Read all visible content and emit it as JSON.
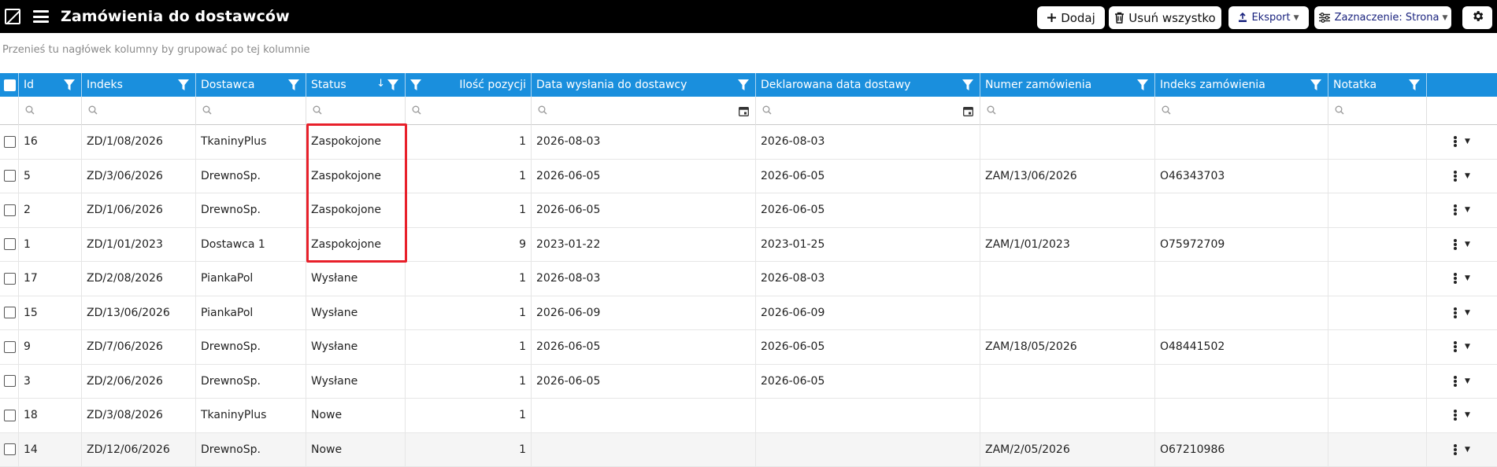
{
  "header": {
    "title": "Zamówienia do dostawców",
    "add_label": "Dodaj",
    "delete_all_label": "Usuń wszystko",
    "export_label": "Eksport",
    "selection_label": "Zaznaczenie: Strona"
  },
  "group_panel": {
    "hint": "Przenieś tu nagłówek kolumny by grupować po tej kolumnie"
  },
  "grid": {
    "columns": {
      "id": "Id",
      "index": "Indeks",
      "supplier": "Dostawca",
      "status": "Status",
      "item_count": "Ilość pozycji",
      "sent_date": "Data wysłania do dostawcy",
      "declared_date": "Deklarowana data dostawy",
      "order_number": "Numer zamówienia",
      "order_index": "Indeks zamówienia",
      "note": "Notatka"
    },
    "sort": {
      "column": "status",
      "direction": "descending"
    },
    "rows": [
      {
        "id": "16",
        "index": "ZD/1/08/2026",
        "supplier": "TkaninyPlus",
        "status": "Zaspokojone",
        "items": "1",
        "sent": "2026-08-03",
        "declared": "2026-08-03",
        "order_no": "",
        "order_index": "",
        "note": ""
      },
      {
        "id": "5",
        "index": "ZD/3/06/2026",
        "supplier": "DrewnoSp.",
        "status": "Zaspokojone",
        "items": "1",
        "sent": "2026-06-05",
        "declared": "2026-06-05",
        "order_no": "ZAM/13/06/2026",
        "order_index": "O46343703",
        "note": ""
      },
      {
        "id": "2",
        "index": "ZD/1/06/2026",
        "supplier": "DrewnoSp.",
        "status": "Zaspokojone",
        "items": "1",
        "sent": "2026-06-05",
        "declared": "2026-06-05",
        "order_no": "",
        "order_index": "",
        "note": ""
      },
      {
        "id": "1",
        "index": "ZD/1/01/2023",
        "supplier": "Dostawca 1",
        "status": "Zaspokojone",
        "items": "9",
        "sent": "2023-01-22",
        "declared": "2023-01-25",
        "order_no": "ZAM/1/01/2023",
        "order_index": "O75972709",
        "note": ""
      },
      {
        "id": "17",
        "index": "ZD/2/08/2026",
        "supplier": "PiankaPol",
        "status": "Wysłane",
        "items": "1",
        "sent": "2026-08-03",
        "declared": "2026-08-03",
        "order_no": "",
        "order_index": "",
        "note": ""
      },
      {
        "id": "15",
        "index": "ZD/13/06/2026",
        "supplier": "PiankaPol",
        "status": "Wysłane",
        "items": "1",
        "sent": "2026-06-09",
        "declared": "2026-06-09",
        "order_no": "",
        "order_index": "",
        "note": ""
      },
      {
        "id": "9",
        "index": "ZD/7/06/2026",
        "supplier": "DrewnoSp.",
        "status": "Wysłane",
        "items": "1",
        "sent": "2026-06-05",
        "declared": "2026-06-05",
        "order_no": "ZAM/18/05/2026",
        "order_index": "O48441502",
        "note": ""
      },
      {
        "id": "3",
        "index": "ZD/2/06/2026",
        "supplier": "DrewnoSp.",
        "status": "Wysłane",
        "items": "1",
        "sent": "2026-06-05",
        "declared": "2026-06-05",
        "order_no": "",
        "order_index": "",
        "note": ""
      },
      {
        "id": "18",
        "index": "ZD/3/08/2026",
        "supplier": "TkaninyPlus",
        "status": "Nowe",
        "items": "1",
        "sent": "",
        "declared": "",
        "order_no": "",
        "order_index": "",
        "note": ""
      },
      {
        "id": "14",
        "index": "ZD/12/06/2026",
        "supplier": "DrewnoSp.",
        "status": "Nowe",
        "items": "1",
        "sent": "",
        "declared": "",
        "order_no": "ZAM/2/05/2026",
        "order_index": "O67210986",
        "note": ""
      }
    ]
  },
  "icons": {
    "logo": "app-logo-icon",
    "menu": "hamburger-menu-icon",
    "add": "plus-icon",
    "delete": "trash-icon",
    "export": "export-icon",
    "selection": "sliders-icon",
    "settings": "gear-icon",
    "filter": "funnel-icon",
    "search": "magnifier-icon",
    "calendar": "calendar-icon",
    "row_menu": "kebab-menu-icon"
  },
  "colors": {
    "topbar": "#000000",
    "header": "#1a8fdd",
    "highlight": "#e8202a"
  }
}
